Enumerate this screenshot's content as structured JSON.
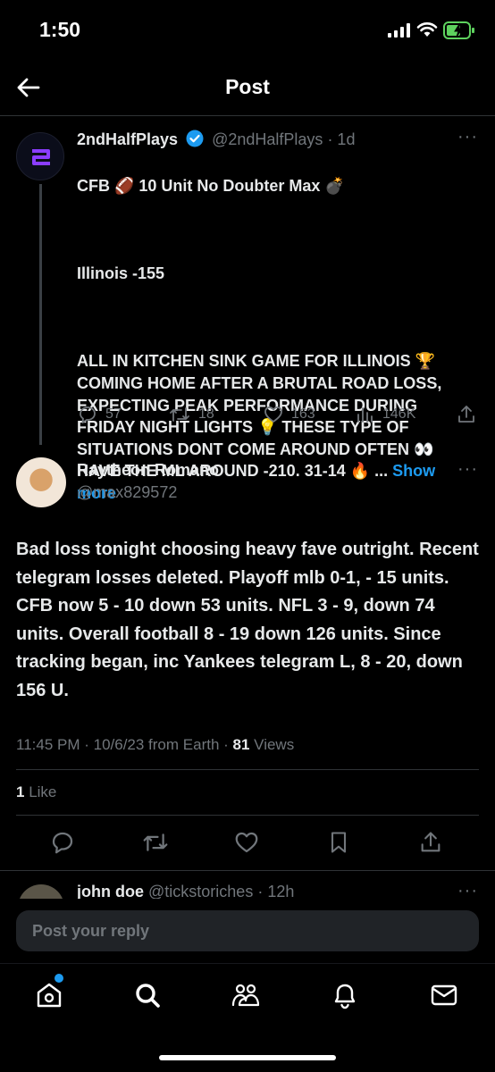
{
  "status_bar": {
    "time": "1:50"
  },
  "header": {
    "title": "Post"
  },
  "original_post": {
    "author_name": "2ndHalfPlays",
    "handle": "@2ndHalfPlays",
    "age": "· 1d",
    "line1": "CFB 🏈 10 Unit No Doubter Max 💣",
    "line2": "Illinois -155",
    "body": "ALL IN KITCHEN SINK GAME FOR ILLINOIS 🏆\nCOMING HOME AFTER A BRUTAL ROAD LOSS,\nEXPECTING PEAK PERFORMANCE DURING\nFRIDAY NIGHT LIGHTS 💡  THESE TYPE OF\nSITUATIONS DONT COME AROUND OFTEN 👀\nHAVE THE ML AROUND -210. 31-14 🔥 ...",
    "show_more": "Show\nmore",
    "stats": {
      "replies": "57",
      "reposts": "18",
      "likes": "163",
      "views": "146K"
    }
  },
  "reply_post": {
    "author_name": "Raytheon Romano",
    "handle": "@max829572",
    "text": "Bad loss tonight choosing heavy fave outright. Recent telegram losses deleted. Playoff mlb 0-1, - 15 units.   CFB now 5 - 10 down 53 units.  NFL 3 - 9, down 74 units.  Overall football 8 - 19 down 126 units.  Since tracking began, inc Yankees telegram L, 8 - 20, down 156 U.",
    "meta_time": "11:45 PM · 10/6/23 from Earth · ",
    "view_count": "81",
    "views_label": " Views",
    "like_count": "1",
    "likes_label": " Like"
  },
  "next_reply": {
    "author_name": "john doe",
    "handle": "@tickstoriches",
    "age": "· 12h"
  },
  "composer": {
    "placeholder": "Post your reply"
  },
  "colors": {
    "accent": "#1d9bf0",
    "background": "#000000",
    "muted": "#71767b",
    "text": "#e7e9ea"
  },
  "icons": [
    "back-arrow-icon",
    "verified-icon",
    "reply-icon",
    "repost-icon",
    "like-icon",
    "views-icon",
    "share-icon",
    "bookmark-icon",
    "home-icon",
    "search-icon",
    "communities-icon",
    "notifications-icon",
    "messages-icon"
  ]
}
